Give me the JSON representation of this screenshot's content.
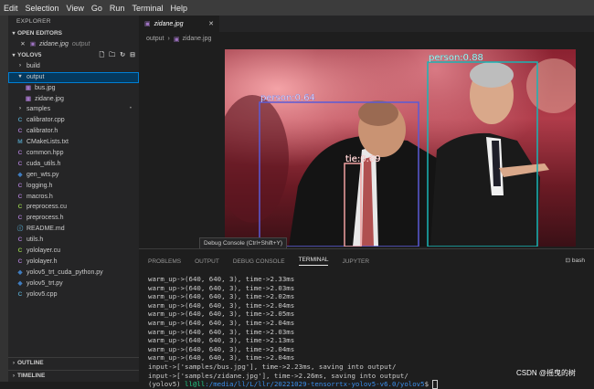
{
  "menu": [
    "Edit",
    "Selection",
    "View",
    "Go",
    "Run",
    "Terminal",
    "Help"
  ],
  "explorer": {
    "title": "EXPLORER",
    "open_editors": {
      "label": "OPEN EDITORS",
      "file": "zidane.jpg",
      "desc": "output"
    },
    "project": {
      "label": "YOLOV5"
    },
    "tree": [
      {
        "name": "build",
        "icon": "chevron-right",
        "kind": "folder",
        "depth": 1
      },
      {
        "name": "output",
        "icon": "chevron-down",
        "kind": "folder",
        "depth": 1,
        "selected": true
      },
      {
        "name": "bus.jpg",
        "icon": "image-icon",
        "kind": "image",
        "depth": 2
      },
      {
        "name": "zidane.jpg",
        "icon": "image-icon",
        "kind": "image",
        "depth": 2
      },
      {
        "name": "samples",
        "icon": "chevron-right",
        "kind": "folder",
        "depth": 1,
        "modified": "•"
      },
      {
        "name": "calibrator.cpp",
        "icon": "cpp-icon",
        "kind": "cpp",
        "depth": 1
      },
      {
        "name": "calibrator.h",
        "icon": "c-icon",
        "kind": "h",
        "depth": 1
      },
      {
        "name": "CMakeLists.txt",
        "icon": "cmake-icon",
        "kind": "cmake",
        "depth": 1
      },
      {
        "name": "common.hpp",
        "icon": "c-icon",
        "kind": "h",
        "depth": 1
      },
      {
        "name": "cuda_utils.h",
        "icon": "c-icon",
        "kind": "h",
        "depth": 1
      },
      {
        "name": "gen_wts.py",
        "icon": "python-icon",
        "kind": "py",
        "depth": 1
      },
      {
        "name": "logging.h",
        "icon": "c-icon",
        "kind": "h",
        "depth": 1
      },
      {
        "name": "macros.h",
        "icon": "c-icon",
        "kind": "h",
        "depth": 1
      },
      {
        "name": "preprocess.cu",
        "icon": "cuda-icon",
        "kind": "cu",
        "depth": 1
      },
      {
        "name": "preprocess.h",
        "icon": "c-icon",
        "kind": "h",
        "depth": 1
      },
      {
        "name": "README.md",
        "icon": "markdown-icon",
        "kind": "md",
        "depth": 1
      },
      {
        "name": "utils.h",
        "icon": "c-icon",
        "kind": "h",
        "depth": 1
      },
      {
        "name": "yololayer.cu",
        "icon": "cuda-icon",
        "kind": "cu",
        "depth": 1
      },
      {
        "name": "yololayer.h",
        "icon": "c-icon",
        "kind": "h",
        "depth": 1
      },
      {
        "name": "yolov5_trt_cuda_python.py",
        "icon": "python-icon",
        "kind": "py",
        "depth": 1
      },
      {
        "name": "yolov5_trt.py",
        "icon": "python-icon",
        "kind": "py",
        "depth": 1
      },
      {
        "name": "yolov5.cpp",
        "icon": "cpp-icon",
        "kind": "cpp",
        "depth": 1
      }
    ],
    "outline": "OUTLINE",
    "timeline": "TIMELINE"
  },
  "editor": {
    "tab": "zidane.jpg",
    "breadcrumb": [
      "output",
      "zidane.jpg"
    ],
    "detections": [
      {
        "label": "person:0.88",
        "color": "#19b5b5"
      },
      {
        "label": "person:0.64",
        "color": "#5b5bd6"
      },
      {
        "label": "tie:0.69",
        "color": "#f0a0a0"
      }
    ]
  },
  "tooltip": "Debug Console (Ctrl+Shift+Y)",
  "panel": {
    "tabs": [
      "PROBLEMS",
      "OUTPUT",
      "DEBUG CONSOLE",
      "TERMINAL",
      "JUPYTER"
    ],
    "active_tab": "TERMINAL",
    "shell": "bash",
    "lines": [
      "warm_up->(640, 640, 3), time->2.33ms",
      "warm_up->(640, 640, 3), time->2.03ms",
      "warm_up->(640, 640, 3), time->2.02ms",
      "warm_up->(640, 640, 3), time->2.04ms",
      "warm_up->(640, 640, 3), time->2.05ms",
      "warm_up->(640, 640, 3), time->2.04ms",
      "warm_up->(640, 640, 3), time->2.03ms",
      "warm_up->(640, 640, 3), time->2.13ms",
      "warm_up->(640, 640, 3), time->2.04ms",
      "warm_up->(640, 640, 3), time->2.04ms",
      "input->['samples/bus.jpg'], time->2.23ms, saving into output/",
      "input->['samples/zidane.jpg'], time->2.26ms, saving into output/"
    ],
    "prompt_env": "(yolov5) ",
    "prompt_user": "ll@ll",
    "prompt_path": ":/media/ll/L/llr/20221029-tensorrtx-yolov5-v6.0/yolov5",
    "prompt_end": "$ "
  },
  "watermark": "CSDN @摇曳的树"
}
